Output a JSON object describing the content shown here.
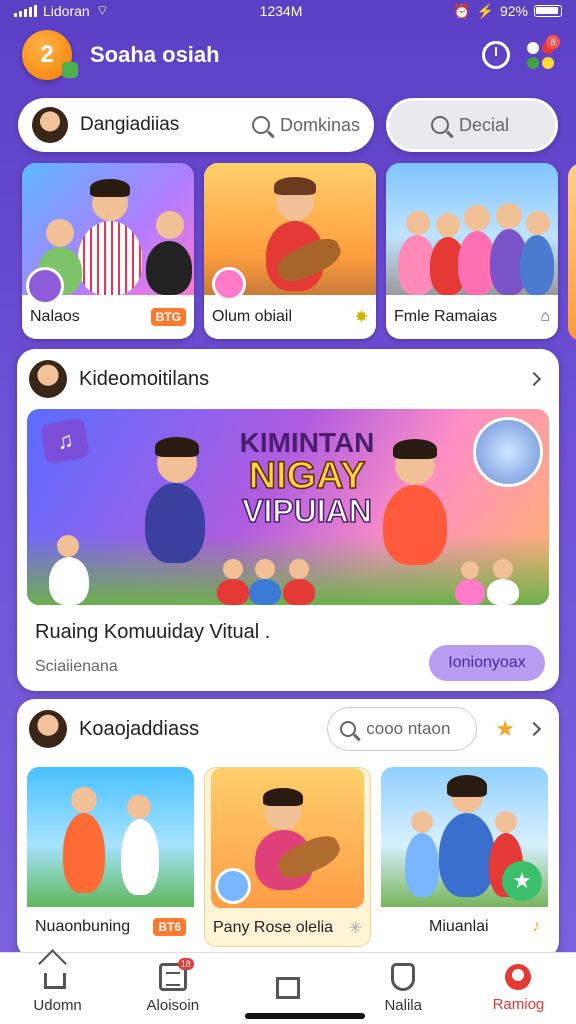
{
  "status": {
    "carrier": "Lidoran",
    "time": "1234M",
    "battery": "92%"
  },
  "app": {
    "logo_text": "2",
    "title": "Soaha osiah",
    "notif_count": "8"
  },
  "search": {
    "profile_label": "Dangiadiias",
    "placeholder": "Domkinas",
    "secondary_label": "Decial"
  },
  "featured": [
    {
      "label": "Nalaos",
      "tag": "BTG"
    },
    {
      "label": "Olum obiail",
      "tag": ""
    },
    {
      "label": "Fmle Ramaias",
      "tag": ""
    }
  ],
  "community": {
    "section_title": "Kideomoitilans",
    "banner_lines": [
      "KIMINTAN",
      "NIGAY",
      "VIPUIAN"
    ],
    "title": "Ruaing Komuuiday Vitual .",
    "subtitle": "Sciaiienana",
    "join_label": "Ionionyoax"
  },
  "friends": {
    "section_title": "Koaojaddiass",
    "search_placeholder": "cooo ntaon",
    "cards": [
      {
        "label": "Nuaonbuning",
        "tag": "BT6"
      },
      {
        "label": "Pany Rose olelia",
        "tag": ""
      },
      {
        "label": "Miuanlai",
        "tag": ""
      }
    ]
  },
  "nav": [
    {
      "label": "Udomn",
      "active": false
    },
    {
      "label": "Aloisoin",
      "active": false,
      "badge": "18"
    },
    {
      "label": "",
      "active": false
    },
    {
      "label": "Nalila",
      "active": false
    },
    {
      "label": "Ramiog",
      "active": true
    }
  ],
  "colors": {
    "accent": "#e53935",
    "primary": "#6e4fd6",
    "tag": "#ff7a2f"
  }
}
